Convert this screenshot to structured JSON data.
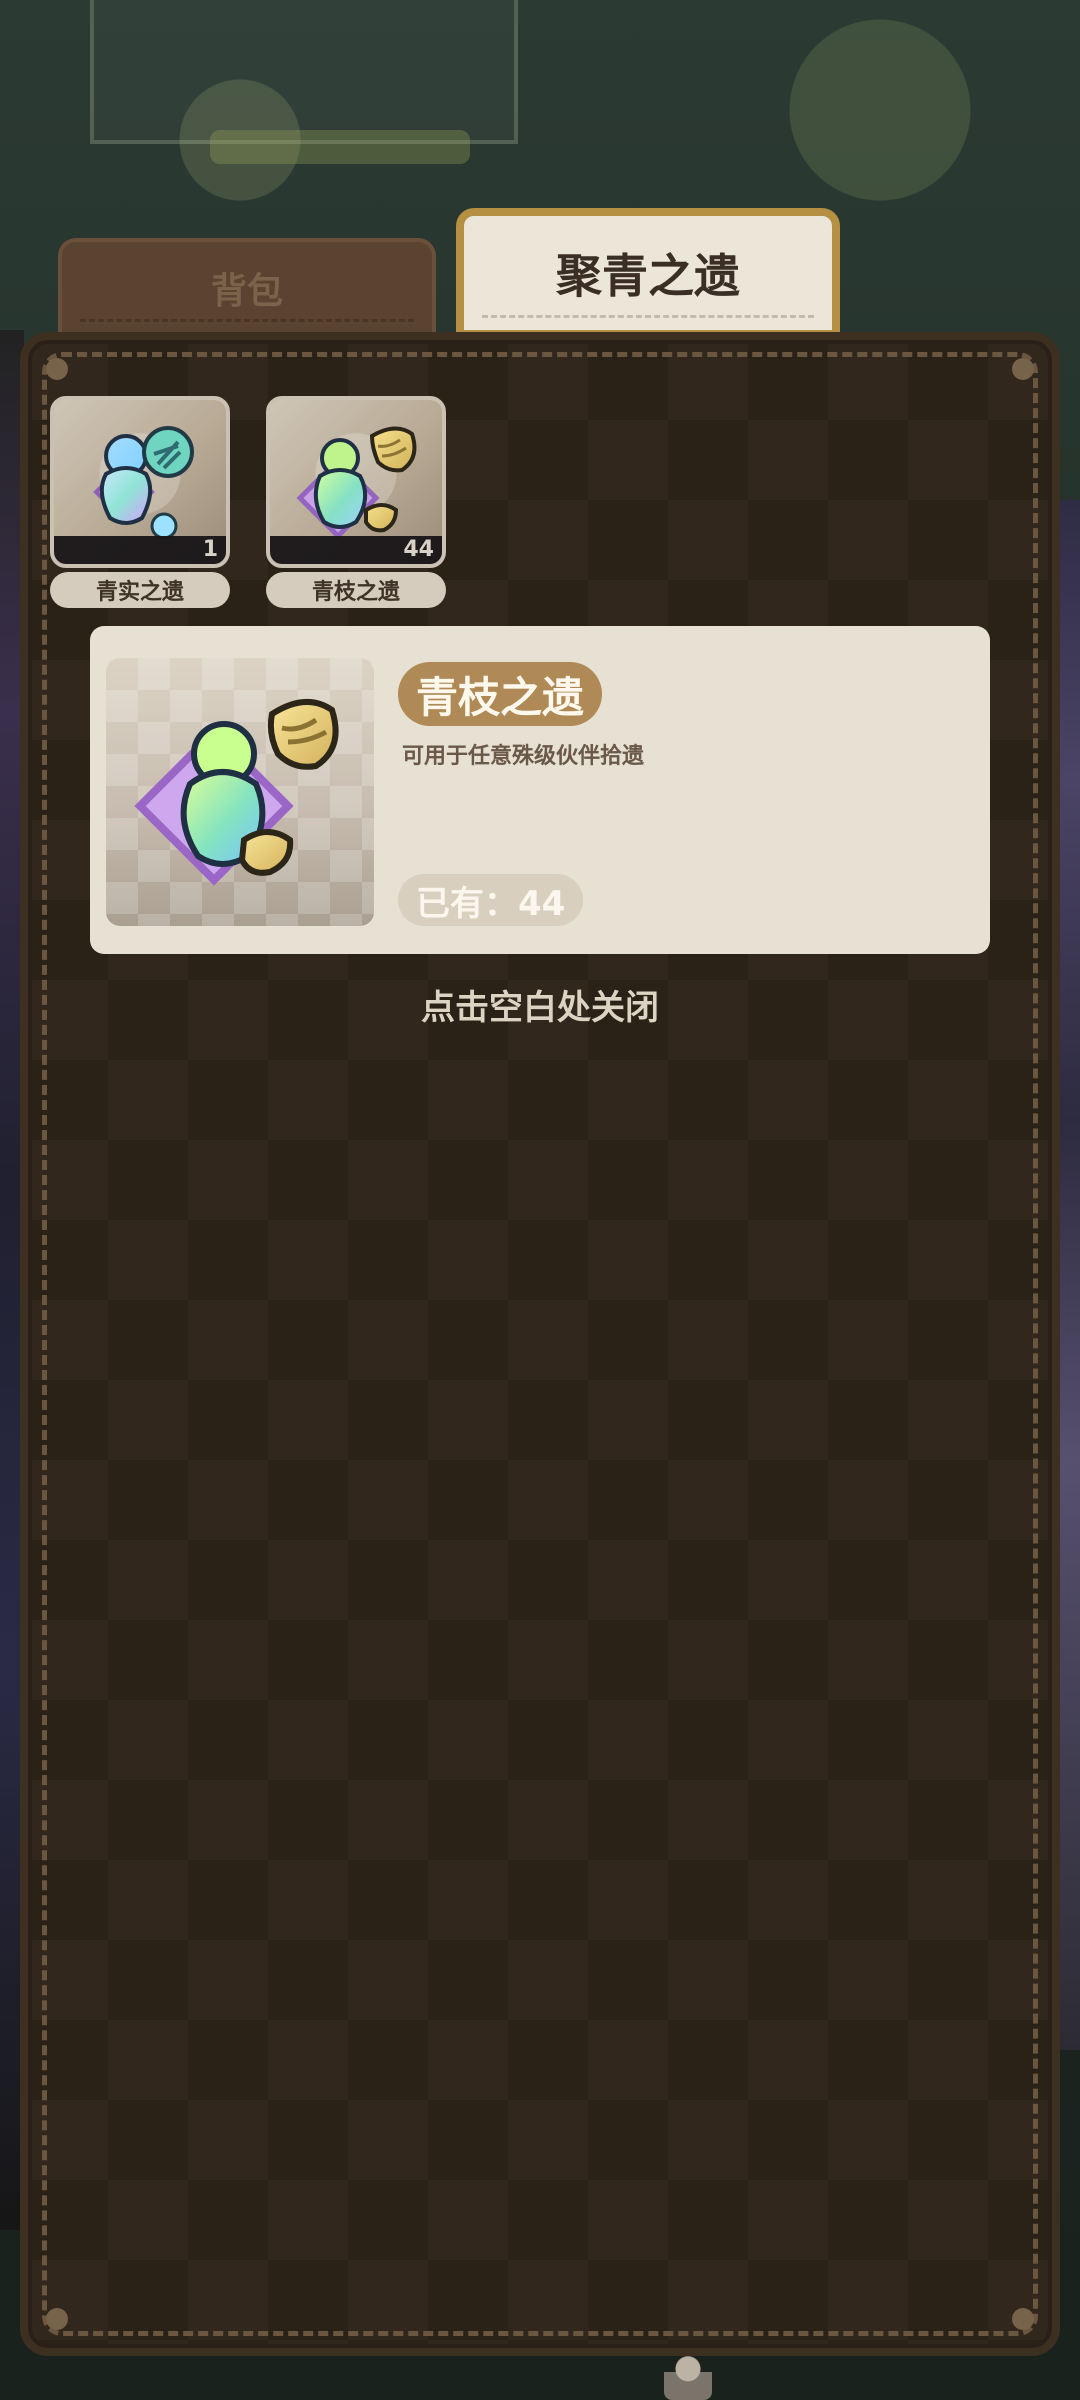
{
  "tabs": {
    "backpack": "背包",
    "relics": "聚青之遗"
  },
  "inventory": [
    {
      "name": "青实之遗",
      "count": "1",
      "icon": "green-relic-icon"
    },
    {
      "name": "青枝之遗",
      "count": "44",
      "icon": "branch-relic-icon"
    }
  ],
  "detail": {
    "title": "青枝之遗",
    "description": "可用于任意殊级伙伴拾遗",
    "owned": "已有：44",
    "icon": "branch-relic-icon"
  },
  "close_hint": "点击空白处关闭",
  "colors": {
    "panel_bg": "#32271c",
    "panel_dash": "#6b5740",
    "tab_active_bg": "#ece6d8",
    "tab_active_border": "#b59042",
    "detail_bg": "#e7e1d3",
    "detail_title_bg": "#b08a56"
  }
}
